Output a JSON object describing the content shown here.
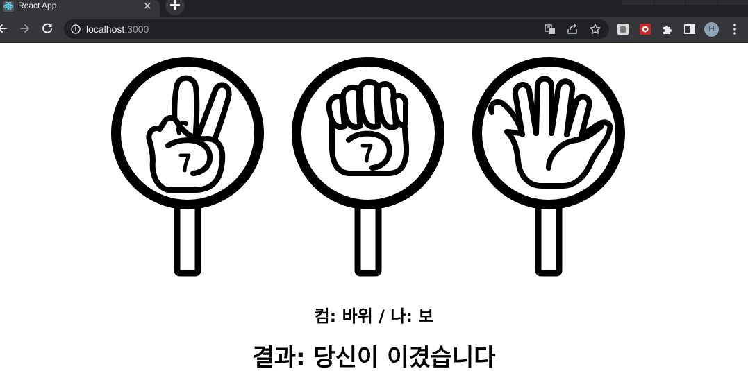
{
  "browser": {
    "tab_title": "React App",
    "tab_close": "×",
    "new_tab": "+",
    "url_host": "localhost",
    "url_port": ":3000",
    "avatar_letter": "H",
    "icons": [
      "react-logo-icon",
      "back-icon",
      "forward-icon",
      "reload-icon",
      "info-icon",
      "translate-icon",
      "share-icon",
      "star-icon",
      "extension-icon",
      "puzzle-icon",
      "side-panel-icon",
      "menu-icon"
    ]
  },
  "game": {
    "choices": [
      {
        "name": "scissors"
      },
      {
        "name": "rock"
      },
      {
        "name": "paper"
      }
    ],
    "picks_text": "컴: 바위 / 나: 보",
    "result_text": "결과: 당신이 이겼습니다"
  }
}
